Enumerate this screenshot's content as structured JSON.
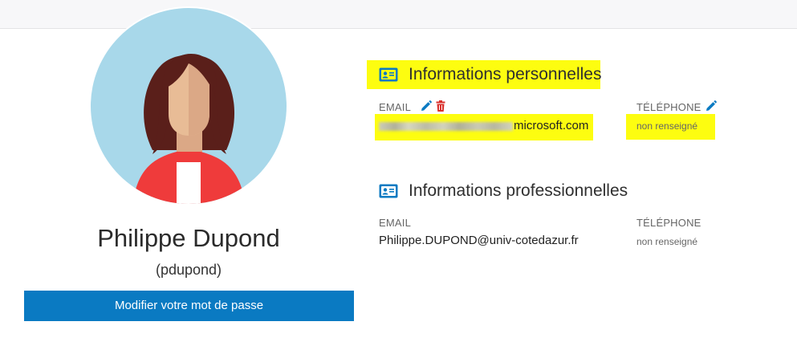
{
  "user": {
    "full_name": "Philippe Dupond",
    "login": "(pdupond)",
    "change_password_label": "Modifier votre mot de passe"
  },
  "personal": {
    "title": "Informations personnelles",
    "email_label": "EMAIL",
    "email_value_suffix": "microsoft.com",
    "phone_label": "TÉLÉPHONE",
    "phone_value": "non renseigné"
  },
  "professional": {
    "title": "Informations professionnelles",
    "email_label": "EMAIL",
    "email_value": "Philippe.DUPOND@univ-cotedazur.fr",
    "phone_label": "TÉLÉPHONE",
    "phone_value": "non renseigné"
  },
  "colors": {
    "accent": "#0a7ac2",
    "highlight": "#fdfd10",
    "delete": "#d9302c",
    "avatar_bg": "#a8d8ea"
  },
  "icons": {
    "section": "id-card-icon",
    "edit": "pencil-icon",
    "delete": "trash-icon"
  }
}
